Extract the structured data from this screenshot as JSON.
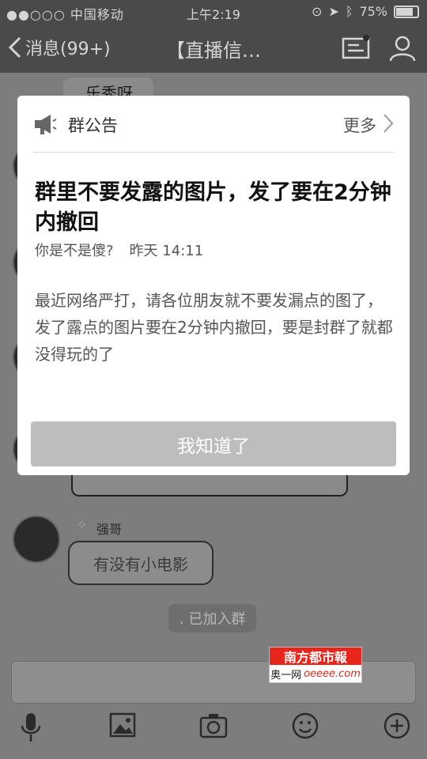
{
  "status_bar": {
    "carrier": "●●○○○ 中国移动",
    "time": "上午2:19",
    "battery": "75%",
    "battery_level": 0.75
  },
  "nav": {
    "back_label": "消息(99+)",
    "title": "【直播信…"
  },
  "chat": {
    "partial_message": "乐秀呀",
    "member_name": "强哥",
    "member_message": "有没有小电影",
    "join_tip": ". 已加入群"
  },
  "announcement": {
    "header_title": "群公告",
    "more_label": "更多",
    "subject": "群里不要发露的图片，发了要在2分钟内撤回",
    "author": "你是不是傻?",
    "timestamp": "昨天 14:11",
    "body": "最近网络严打，请各位朋友就不要发漏点的图了，发了露点的图片要在2分钟内撤回，要是封群了就都没得玩的了",
    "confirm_label": "我知道了"
  },
  "watermark": {
    "name": "南方都市報",
    "site_label": "奥一网",
    "site_url": "oeeee.com"
  },
  "icons": {
    "megaphone": "megaphone-icon",
    "chevron": "chevron-right-icon",
    "mic": "microphone-icon",
    "image": "image-icon",
    "camera": "camera-icon",
    "emoji": "emoji-icon",
    "plus": "plus-circle-icon"
  }
}
